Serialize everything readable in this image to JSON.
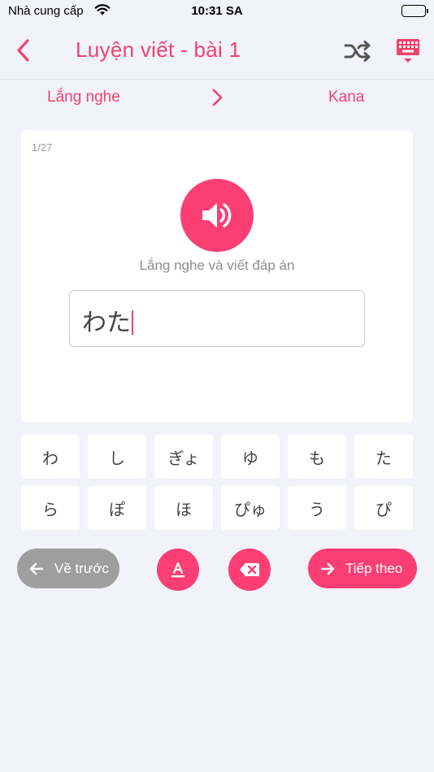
{
  "status_bar": {
    "carrier": "Nhà cung cấp",
    "time": "10:31 SA"
  },
  "nav": {
    "title": "Luyện viết - bài 1",
    "icons": [
      "back-chevron-icon",
      "shuffle-icon",
      "keyboard-icon"
    ],
    "accent_color": "#f0426e"
  },
  "mode": {
    "from": "Lắng nghe",
    "to": "Kana"
  },
  "card": {
    "counter": "1/27",
    "instruction": "Lắng nghe và viết đáp án",
    "answer_value": "わた"
  },
  "kana_keys": [
    [
      "わ",
      "し",
      "ぎょ",
      "ゆ",
      "も",
      "た"
    ],
    [
      "ら",
      "ぽ",
      "ほ",
      "ぴゅ",
      "う",
      "ぴ"
    ]
  ],
  "actions": {
    "prev_label": "Về trước",
    "next_label": "Tiếp theo",
    "button_color": "#fb3f74",
    "prev_color": "#9e9e9e"
  }
}
